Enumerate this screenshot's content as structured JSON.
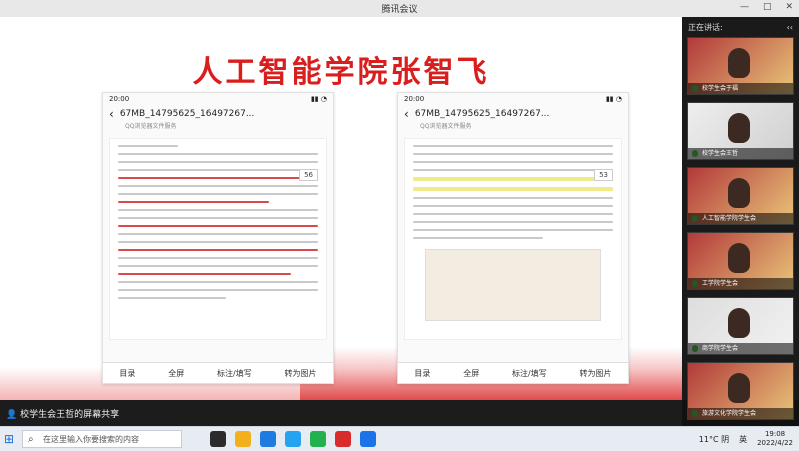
{
  "window": {
    "title": "腾讯会议",
    "controls": [
      "—",
      "□",
      "✕"
    ]
  },
  "slide": {
    "title": "人工智能学院张智飞",
    "docs": [
      {
        "time": "20:00",
        "filename": "67MB_14795625_16497267...",
        "subtitle": "QQ浏览器文件服务",
        "page": "56"
      },
      {
        "time": "20:00",
        "filename": "67MB_14795625_16497267...",
        "subtitle": "QQ浏览器文件服务",
        "page": "53"
      }
    ],
    "toolbar": [
      "目录",
      "全屏",
      "标注/填写",
      "转为图片"
    ]
  },
  "sidebar": {
    "speaking_label": "正在讲话:",
    "participants": [
      "校学生会于福",
      "校学生会王哲",
      "人工智能学院学生会",
      "工学院学生会",
      "商学院学生会",
      "旅游文化学院学生会"
    ]
  },
  "share_bar": {
    "label": "校学生会王哲的屏幕共享"
  },
  "taskbar": {
    "search_placeholder": "在这里输入你要搜索的内容",
    "weather": "11°C 阴",
    "lang": "英",
    "time": "19:08",
    "date": "2022/4/22",
    "icon_colors": [
      "#2b2b2b",
      "#f2b01e",
      "#1f7be0",
      "#25a3f0",
      "#d92b2b",
      "#23b14d",
      "#d33",
      "#1a73e8"
    ]
  }
}
